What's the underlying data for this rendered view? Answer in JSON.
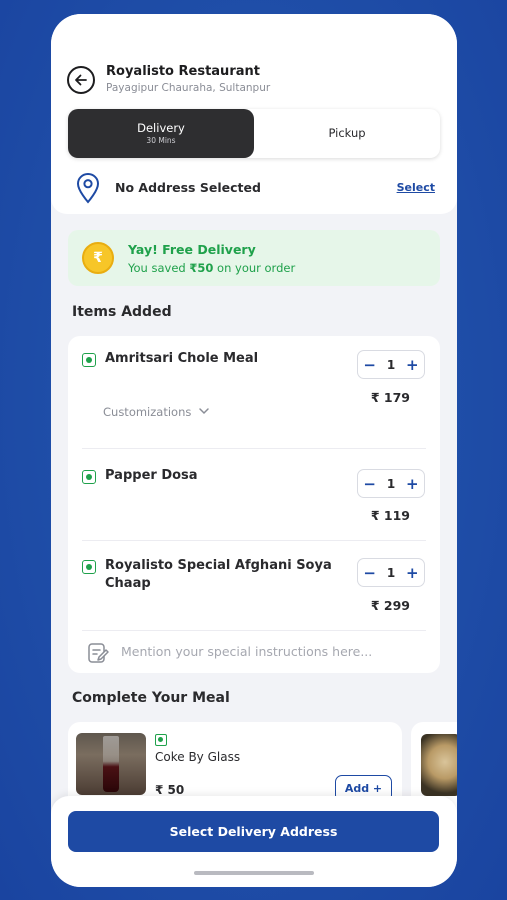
{
  "restaurant": {
    "name": "Royalisto Restaurant",
    "address": "Payagipur Chauraha, Sultanpur"
  },
  "mode_toggle": {
    "delivery_label": "Delivery",
    "delivery_time": "30 Mins",
    "pickup_label": "Pickup",
    "selected": "Delivery"
  },
  "address": {
    "label": "No Address Selected",
    "select_label": "Select"
  },
  "free_delivery": {
    "coin_symbol": "₹",
    "title": "Yay! Free Delivery",
    "saved_prefix": "You saved",
    "saved_amount": "₹50",
    "saved_suffix": "on your order"
  },
  "items_section": {
    "title": "Items Added",
    "items": [
      {
        "name": "Amritsari Chole Meal",
        "qty": "1",
        "price": "₹ 179",
        "customizations": "Customizations"
      },
      {
        "name": "Papper Dosa",
        "qty": "1",
        "price": "₹ 119"
      },
      {
        "name": "Royalisto Special Afghani Soya Chaap",
        "qty": "1",
        "price": "₹ 299"
      }
    ],
    "instructions_placeholder": "Mention your special instructions here..."
  },
  "complete_meal": {
    "title": "Complete Your Meal",
    "items": [
      {
        "name": "Coke By Glass",
        "price": "₹ 50",
        "add_label": "Add +"
      }
    ]
  },
  "cta": {
    "label": "Select Delivery Address"
  },
  "colors": {
    "brand_blue": "#1e4aa4",
    "veg_green": "#1fa14b",
    "banner_bg": "#e6f6e9",
    "toggle_active": "#2e2e30"
  }
}
